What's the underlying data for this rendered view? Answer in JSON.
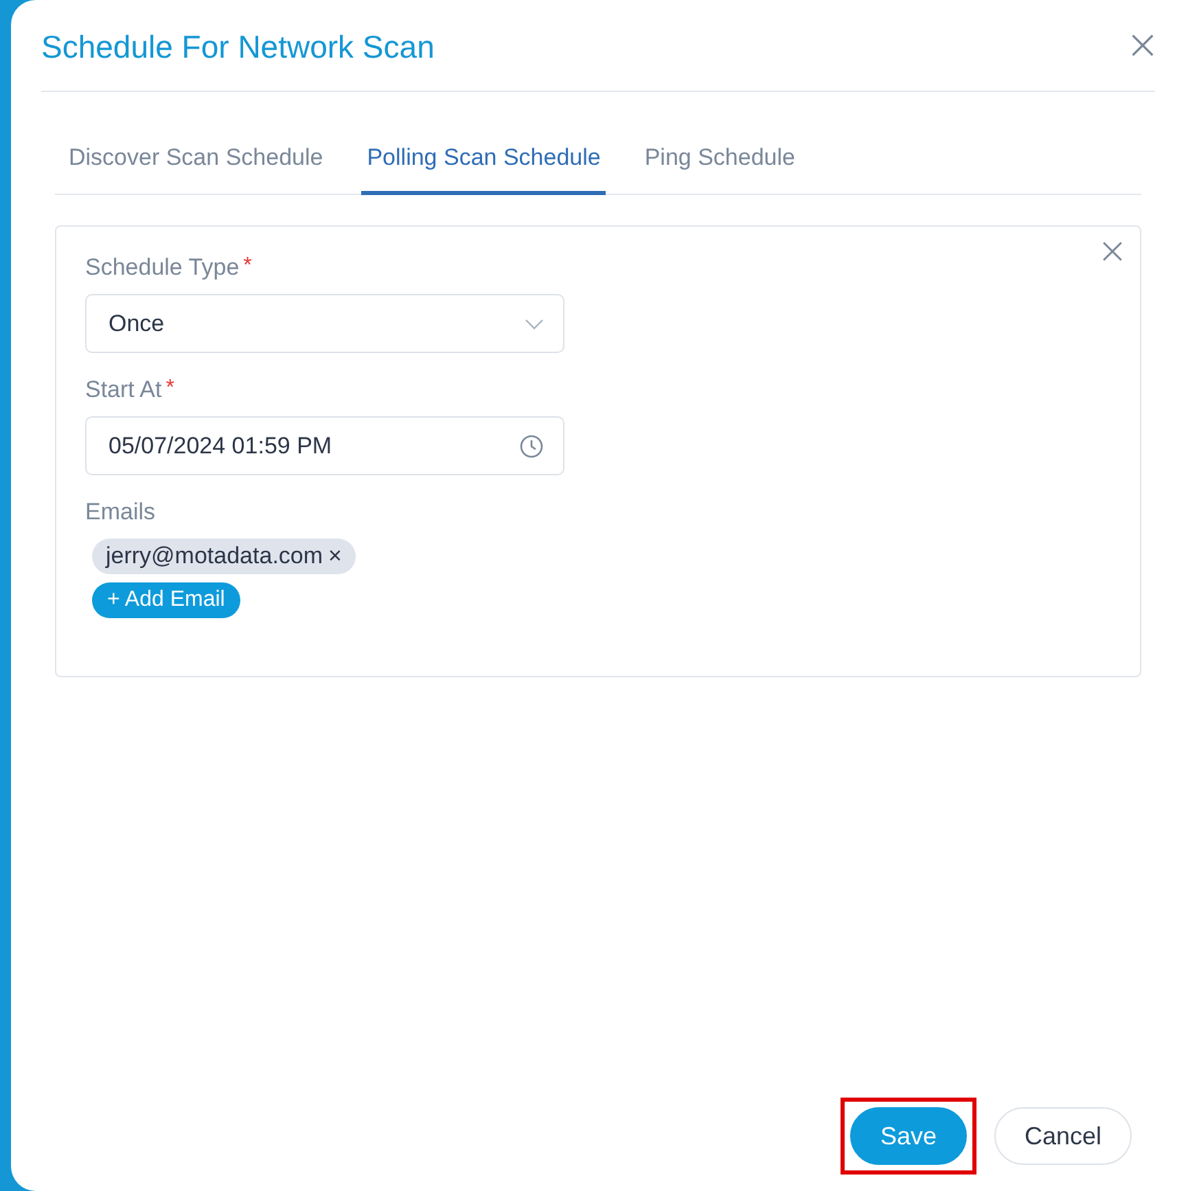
{
  "dialog": {
    "title": "Schedule For Network Scan"
  },
  "tabs": [
    {
      "label": "Discover Scan Schedule",
      "selected": false
    },
    {
      "label": "Polling Scan Schedule",
      "selected": true
    },
    {
      "label": "Ping Schedule",
      "selected": false
    }
  ],
  "form": {
    "schedule_type": {
      "label": "Schedule Type",
      "required_mark": "*",
      "value": "Once"
    },
    "start_at": {
      "label": "Start At",
      "required_mark": "*",
      "value": "05/07/2024 01:59 PM"
    },
    "emails": {
      "label": "Emails",
      "tags": [
        {
          "text": "jerry@motadata.com",
          "remove": "×"
        }
      ],
      "add_button": "+ Add Email"
    }
  },
  "footer": {
    "buttons": [
      {
        "label": "Save",
        "kind": "primary",
        "highlighted": true
      },
      {
        "label": "Cancel",
        "kind": "secondary",
        "highlighted": false
      }
    ]
  }
}
